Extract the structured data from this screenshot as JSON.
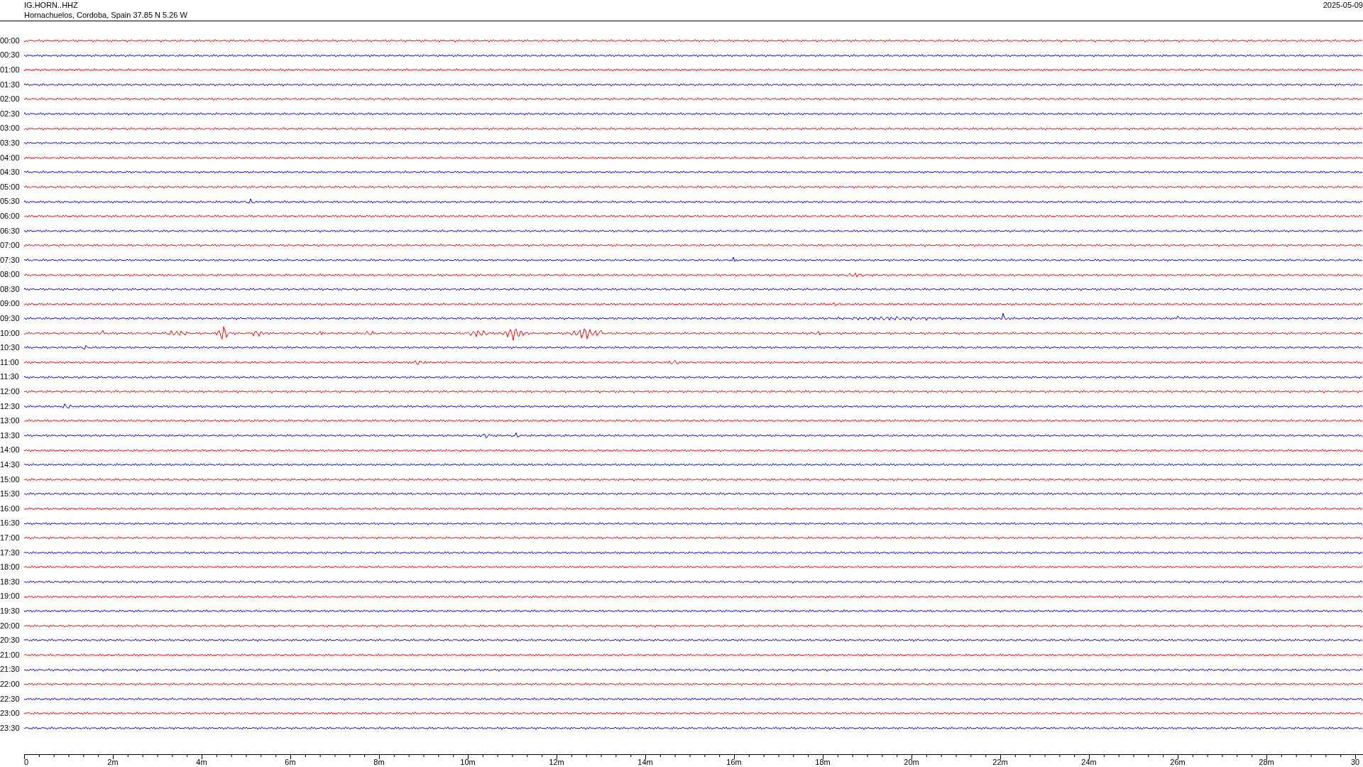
{
  "header": {
    "station": "IG.HORN..HHZ",
    "location": "Hornachuelos, Cordoba, Spain  37.85 N 5.26 W",
    "date": "2025-05-09"
  },
  "rows": [
    {
      "label": "00:00",
      "color": "#ff0000"
    },
    {
      "label": "00:30",
      "color": "#0000ff"
    },
    {
      "label": "01:00",
      "color": "#ff0000"
    },
    {
      "label": "01:30",
      "color": "#0000ff"
    },
    {
      "label": "02:00",
      "color": "#ff0000"
    },
    {
      "label": "02:30",
      "color": "#0000ff"
    },
    {
      "label": "03:00",
      "color": "#ff0000"
    },
    {
      "label": "03:30",
      "color": "#0000ff"
    },
    {
      "label": "04:00",
      "color": "#ff0000"
    },
    {
      "label": "04:30",
      "color": "#0000ff"
    },
    {
      "label": "05:00",
      "color": "#ff0000"
    },
    {
      "label": "05:30",
      "color": "#0000ff"
    },
    {
      "label": "06:00",
      "color": "#ff0000"
    },
    {
      "label": "06:30",
      "color": "#0000ff"
    },
    {
      "label": "07:00",
      "color": "#ff0000"
    },
    {
      "label": "07:30",
      "color": "#0000ff"
    },
    {
      "label": "08:00",
      "color": "#ff0000"
    },
    {
      "label": "08:30",
      "color": "#0000ff"
    },
    {
      "label": "09:00",
      "color": "#ff0000"
    },
    {
      "label": "09:30",
      "color": "#0000ff"
    },
    {
      "label": "10:00",
      "color": "#ff0000"
    },
    {
      "label": "10:30",
      "color": "#0000ff"
    },
    {
      "label": "11:00",
      "color": "#ff0000"
    },
    {
      "label": "11:30",
      "color": "#0000ff"
    },
    {
      "label": "12:00",
      "color": "#ff0000"
    },
    {
      "label": "12:30",
      "color": "#0000ff"
    },
    {
      "label": "13:00",
      "color": "#ff0000"
    },
    {
      "label": "13:30",
      "color": "#0000ff"
    },
    {
      "label": "14:00",
      "color": "#ff0000"
    },
    {
      "label": "14:30",
      "color": "#0000ff"
    },
    {
      "label": "15:00",
      "color": "#ff0000"
    },
    {
      "label": "15:30",
      "color": "#0000ff"
    },
    {
      "label": "16:00",
      "color": "#ff0000"
    },
    {
      "label": "16:30",
      "color": "#0000ff"
    },
    {
      "label": "17:00",
      "color": "#ff0000"
    },
    {
      "label": "17:30",
      "color": "#0000ff"
    },
    {
      "label": "18:00",
      "color": "#ff0000"
    },
    {
      "label": "18:30",
      "color": "#0000ff"
    },
    {
      "label": "19:00",
      "color": "#ff0000"
    },
    {
      "label": "19:30",
      "color": "#0000ff"
    },
    {
      "label": "20:00",
      "color": "#ff0000"
    },
    {
      "label": "20:30",
      "color": "#0000ff"
    },
    {
      "label": "21:00",
      "color": "#ff0000"
    },
    {
      "label": "21:30",
      "color": "#0000ff"
    },
    {
      "label": "22:00",
      "color": "#ff0000"
    },
    {
      "label": "22:30",
      "color": "#0000ff"
    },
    {
      "label": "23:00",
      "color": "#ff0000"
    },
    {
      "label": "23:30",
      "color": "#0000ff"
    }
  ],
  "axis": {
    "tick_labels": [
      "0",
      "2m",
      "4m",
      "6m",
      "8m",
      "10m",
      "12m",
      "14m",
      "16m",
      "18m",
      "20m",
      "22m",
      "24m",
      "26m",
      "28m",
      "30"
    ]
  }
}
